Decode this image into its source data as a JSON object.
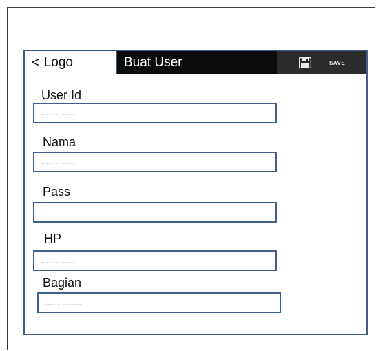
{
  "header": {
    "back_label": "Logo",
    "title": "Buat User",
    "save_label": "SAVE"
  },
  "form": {
    "fields": [
      {
        "label": "User Id",
        "placeholder": "..............."
      },
      {
        "label": "Nama",
        "placeholder": "..............."
      },
      {
        "label": "Pass",
        "placeholder": "..............."
      },
      {
        "label": "HP",
        "placeholder": "..............."
      },
      {
        "label": "Bagian",
        "placeholder": "..............."
      }
    ]
  },
  "colors": {
    "header_bg": "#0b0b0b",
    "save_bg": "#2b2b2b",
    "border": "#3f5f8a"
  }
}
